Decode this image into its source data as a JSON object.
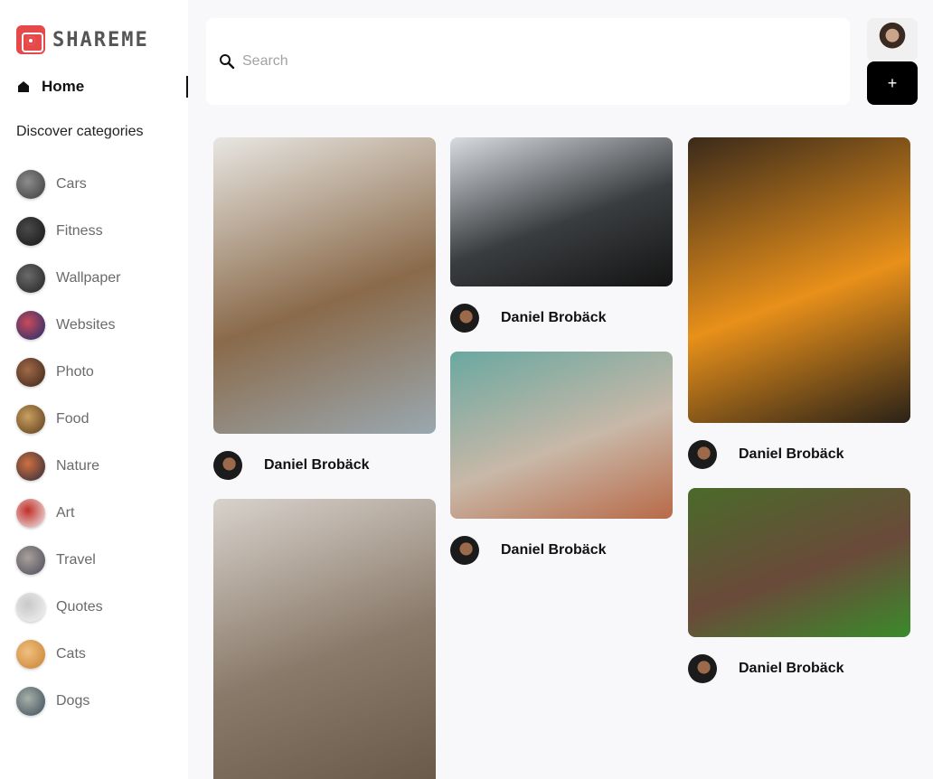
{
  "app": {
    "logo_text": "SHAREME"
  },
  "nav": {
    "home_label": "Home",
    "discover_label": "Discover categories"
  },
  "categories": [
    {
      "label": "Cars",
      "icon": "cars-thumbnail",
      "colors": [
        "#3b3b3b",
        "#8c8c8c"
      ]
    },
    {
      "label": "Fitness",
      "icon": "fitness-thumbnail",
      "colors": [
        "#151515",
        "#4a4a4a"
      ]
    },
    {
      "label": "Wallpaper",
      "icon": "wallpaper-thumbnail",
      "colors": [
        "#222222",
        "#6a6a6a"
      ]
    },
    {
      "label": "Websites",
      "icon": "websites-thumbnail",
      "colors": [
        "#1a2d6b",
        "#c94a5a"
      ]
    },
    {
      "label": "Photo",
      "icon": "photo-thumbnail",
      "colors": [
        "#3a2418",
        "#a06a48"
      ]
    },
    {
      "label": "Food",
      "icon": "food-thumbnail",
      "colors": [
        "#5a3a1a",
        "#c9a060"
      ]
    },
    {
      "label": "Nature",
      "icon": "nature-thumbnail",
      "colors": [
        "#2a2a3a",
        "#d07040"
      ]
    },
    {
      "label": "Art",
      "icon": "art-thumbnail",
      "colors": [
        "#f2f2f2",
        "#c0302a"
      ]
    },
    {
      "label": "Travel",
      "icon": "travel-thumbnail",
      "colors": [
        "#4a4a5a",
        "#a8a09a"
      ]
    },
    {
      "label": "Quotes",
      "icon": "quotes-thumbnail",
      "colors": [
        "#f4f4f4",
        "#c8c8c8"
      ]
    },
    {
      "label": "Cats",
      "icon": "cats-thumbnail",
      "colors": [
        "#c88030",
        "#f0c080"
      ]
    },
    {
      "label": "Dogs",
      "icon": "dogs-thumbnail",
      "colors": [
        "#3a4a5a",
        "#a8b0a8"
      ]
    }
  ],
  "search": {
    "placeholder": "Search",
    "value": ""
  },
  "header": {
    "add_label": "+"
  },
  "pins": [
    {
      "image": "sleeping-tabby-cat-photo",
      "author": "Daniel Brobäck",
      "colors": [
        "#e8e6e2",
        "#8a6a4a",
        "#9aa8b0"
      ]
    },
    {
      "image": "black-sports-car-photo",
      "author": "Daniel Brobäck",
      "colors": [
        "#d8dce0",
        "#3a3d40",
        "#141414"
      ]
    },
    {
      "image": "cat-lying-on-floor-photo",
      "author": "Daniel Brobäck",
      "colors": [
        "#6aa8a0",
        "#c8b8a8",
        "#b86a48"
      ]
    },
    {
      "image": "orange-lamborghini-photo",
      "author": "Daniel Brobäck",
      "colors": [
        "#3a2a1a",
        "#e8901a",
        "#2a2218"
      ]
    },
    {
      "image": "kittens-in-basket-photo",
      "author": "Daniel Brobäck",
      "colors": [
        "#4a6a2a",
        "#6a4a3a",
        "#3a8a2a"
      ]
    },
    {
      "image": "smiling-cat-photo",
      "author": "",
      "colors": [
        "#d8d2cc",
        "#8a7a6a",
        "#6a5a4a"
      ]
    }
  ]
}
